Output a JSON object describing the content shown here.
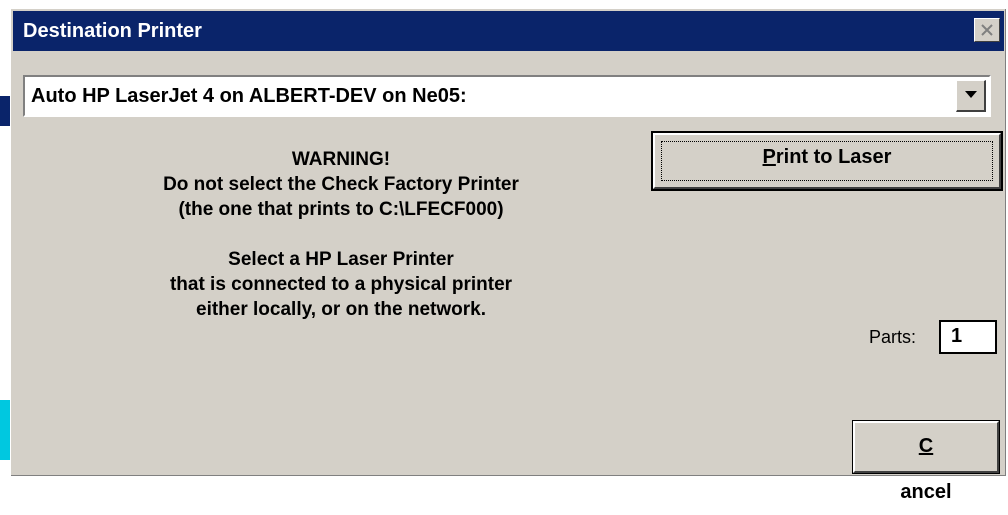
{
  "window": {
    "title": "Destination Printer",
    "close_icon": "close-icon"
  },
  "printer_select": {
    "value": "Auto HP LaserJet 4 on ALBERT-DEV on Ne05:",
    "dropdown_icon": "chevron-down-icon"
  },
  "warning": {
    "line1": "WARNING!",
    "line2": "Do not select the Check Factory Printer",
    "line3": "(the one that prints to C:\\LFECF000)",
    "line4": "Select a HP Laser Printer",
    "line5": "that is connected to a physical printer",
    "line6": "either locally, or on the network."
  },
  "buttons": {
    "print_mnemonic": "P",
    "print_rest": "rint to Laser",
    "cancel_mnemonic": "C",
    "cancel_rest": "ancel"
  },
  "parts": {
    "label": "Parts:",
    "value": "1"
  },
  "colors": {
    "titlebar": "#0a246a",
    "dialog_bg": "#d4d0c8"
  }
}
